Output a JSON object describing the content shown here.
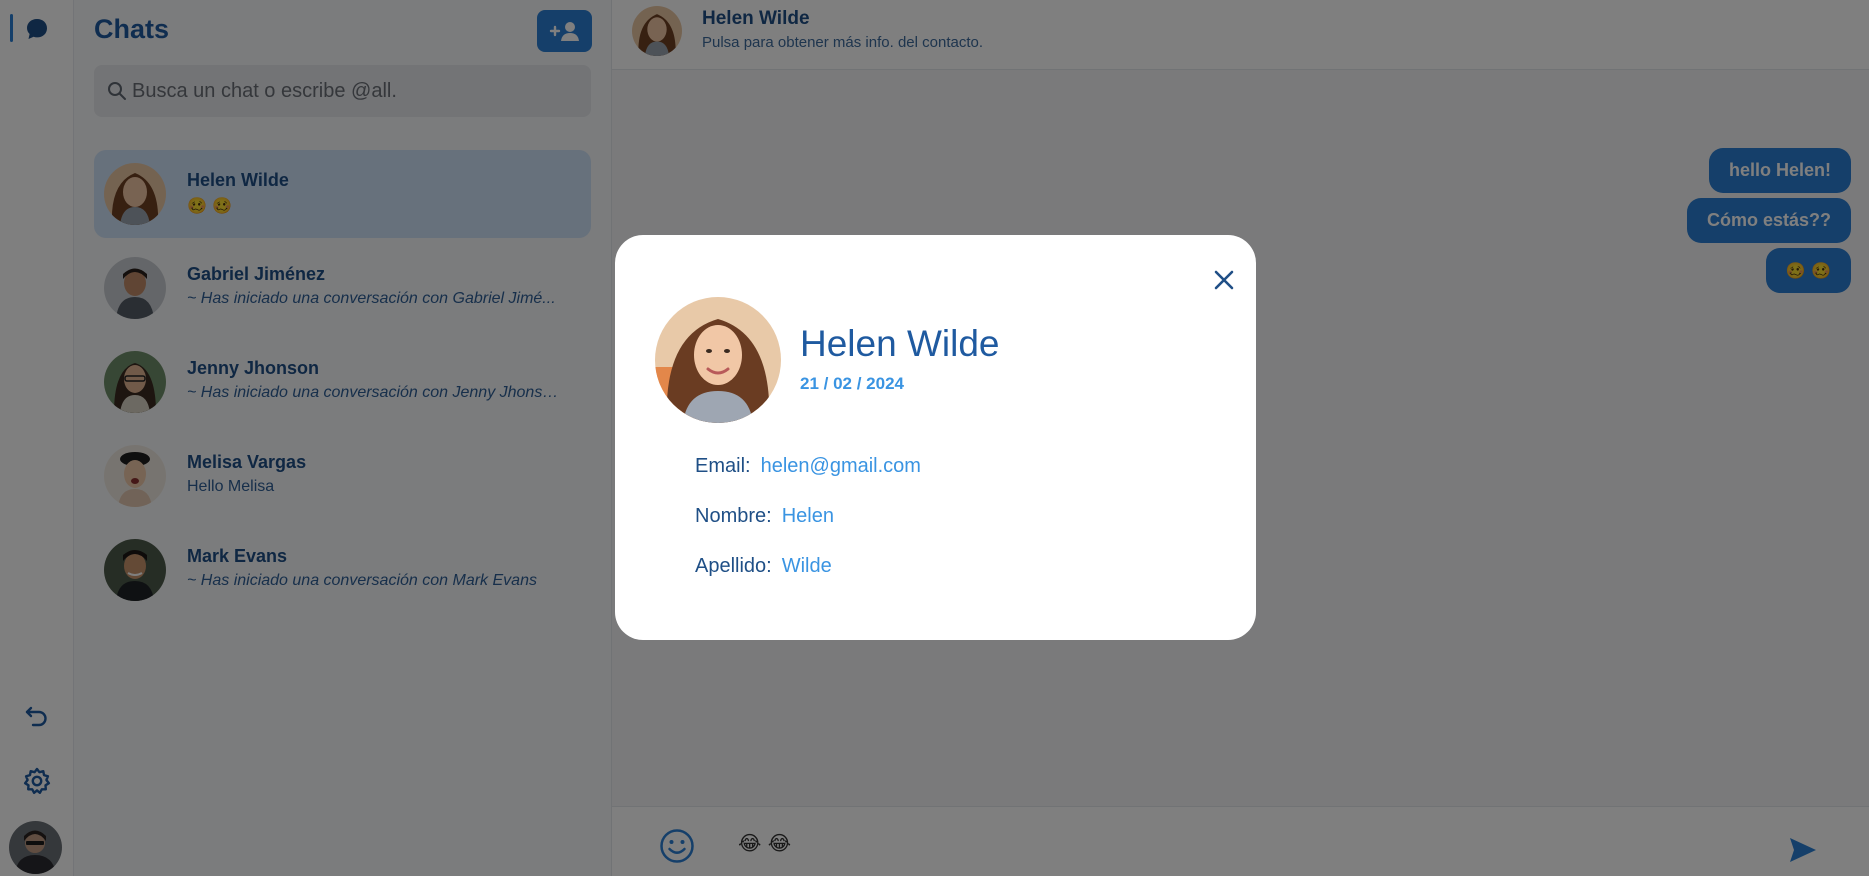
{
  "chat_list": {
    "title": "Chats",
    "search_placeholder": "Busca un chat o escribe @all.",
    "items": [
      {
        "name": "Helen Wilde",
        "preview": "🥴 🥴",
        "active": true
      },
      {
        "name": "Gabriel Jiménez",
        "preview": "~ Has iniciado una conversación con Gabriel Jimé..."
      },
      {
        "name": "Jenny Jhonson",
        "preview": "~ Has iniciado una conversación con Jenny Jhonso..."
      },
      {
        "name": "Melisa Vargas",
        "preview": "Hello Melisa"
      },
      {
        "name": "Mark Evans",
        "preview": "~ Has iniciado una conversación con Mark Evans"
      }
    ]
  },
  "conversation": {
    "contact_name": "Helen Wilde",
    "contact_hint": "Pulsa para obtener más info. del contacto.",
    "messages": [
      {
        "text": "hello Helen!"
      },
      {
        "text": "Cómo estás??"
      },
      {
        "text": "🥴 🥴"
      }
    ],
    "draft": "😂 😂"
  },
  "modal": {
    "name": "Helen Wilde",
    "date": "21 / 02 / 2024",
    "fields": [
      {
        "label": "Email:",
        "value": "helen@gmail.com"
      },
      {
        "label": "Nombre:",
        "value": "Helen"
      },
      {
        "label": "Apellido:",
        "value": "Wilde"
      }
    ]
  },
  "colors": {
    "accent": "#2a7fd4",
    "dark_text": "#1f4f86",
    "link_text": "#3a94e2",
    "active_item": "#cfe2f8",
    "overlay": "rgba(0,0,0,0.5)"
  },
  "icons": {
    "rail_chat": "chat-bubble-icon",
    "rail_undo": "undo-icon",
    "rail_settings": "gear-icon",
    "new_chat": "add-user-icon",
    "search": "search-icon",
    "emoji": "smiley-icon",
    "send": "send-icon",
    "close": "close-icon"
  }
}
